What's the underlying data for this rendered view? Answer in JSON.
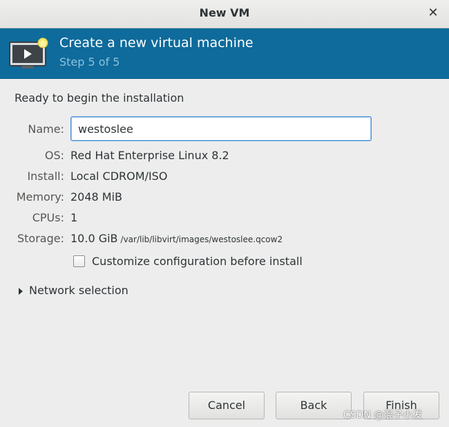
{
  "window": {
    "title": "New VM",
    "close_icon": "close-icon"
  },
  "header": {
    "title": "Create a new virtual machine",
    "step": "Step 5 of 5",
    "icon": "monitor-play-icon",
    "accent_color": "#0e6b9b"
  },
  "content": {
    "ready_text": "Ready to begin the installation",
    "fields": {
      "name_label": "Name:",
      "name_value": "westoslee",
      "os_label": "OS:",
      "os_value": "Red Hat Enterprise Linux 8.2",
      "install_label": "Install:",
      "install_value": "Local CDROM/ISO",
      "memory_label": "Memory:",
      "memory_value": "2048 MiB",
      "cpus_label": "CPUs:",
      "cpus_value": "1",
      "storage_label": "Storage:",
      "storage_value": "10.0 GiB",
      "storage_path": "/var/lib/libvirt/images/westoslee.qcow2"
    },
    "customize_checkbox": {
      "label": "Customize configuration before install",
      "checked": false
    },
    "network_expander": {
      "label": "Network selection",
      "expanded": false
    }
  },
  "buttons": {
    "cancel": "Cancel",
    "back": "Back",
    "finish": "Finish"
  },
  "watermark": "CSDN @混子小发"
}
